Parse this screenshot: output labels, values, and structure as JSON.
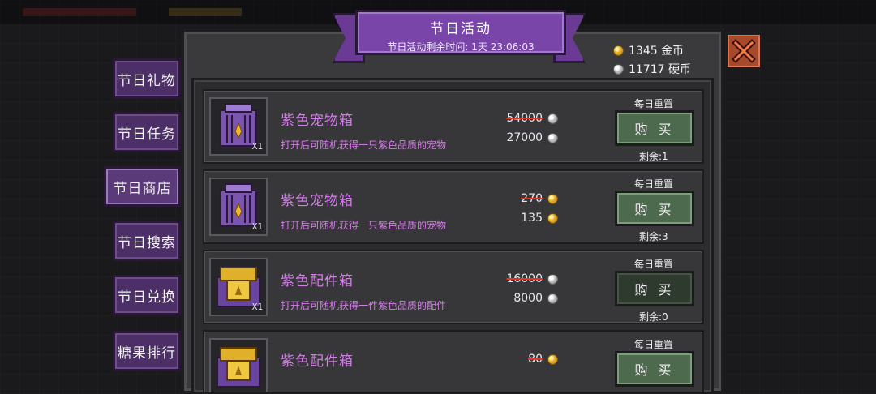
{
  "title": "节日活动",
  "subtitle": "节日活动剩余时间: 1天 23:06:03",
  "currency": {
    "gold": "1345 金币",
    "silver": "11717 硬币"
  },
  "menu": [
    {
      "label": "节日礼物"
    },
    {
      "label": "节日任务"
    },
    {
      "label": "节日商店"
    },
    {
      "label": "节日搜索"
    },
    {
      "label": "节日兑换"
    },
    {
      "label": "糖果排行"
    }
  ],
  "shop_items": [
    {
      "name": "紫色宠物箱",
      "desc": "打开后可随机获得一只紫色品质的宠物",
      "qty": "X1",
      "old_price": "54000",
      "new_price": "27000",
      "coin": "silver",
      "reset": "每日重置",
      "buy": "购 买",
      "remain": "剩余:1",
      "icon": "purple-pet-crate-icon"
    },
    {
      "name": "紫色宠物箱",
      "desc": "打开后可随机获得一只紫色品质的宠物",
      "qty": "X1",
      "old_price": "270",
      "new_price": "135",
      "coin": "gold",
      "reset": "每日重置",
      "buy": "购 买",
      "remain": "剩余:3",
      "icon": "purple-pet-crate-icon"
    },
    {
      "name": "紫色配件箱",
      "desc": "打开后可随机获得一件紫色品质的配件",
      "qty": "X1",
      "old_price": "16000",
      "new_price": "8000",
      "coin": "silver",
      "reset": "每日重置",
      "buy": "购 买",
      "remain": "剩余:0",
      "icon": "purple-accessory-box-icon"
    },
    {
      "name": "紫色配件箱",
      "desc": "",
      "qty": "",
      "old_price": "80",
      "new_price": "",
      "coin": "gold",
      "reset": "每日重置",
      "buy": "购 买",
      "remain": "",
      "icon": "purple-accessory-box-icon"
    }
  ],
  "colors": {
    "item_name": "#d37de8",
    "ribbon": "#7a45a8",
    "buy_button": "#4e6a4e",
    "close_button": "#a8492b"
  }
}
